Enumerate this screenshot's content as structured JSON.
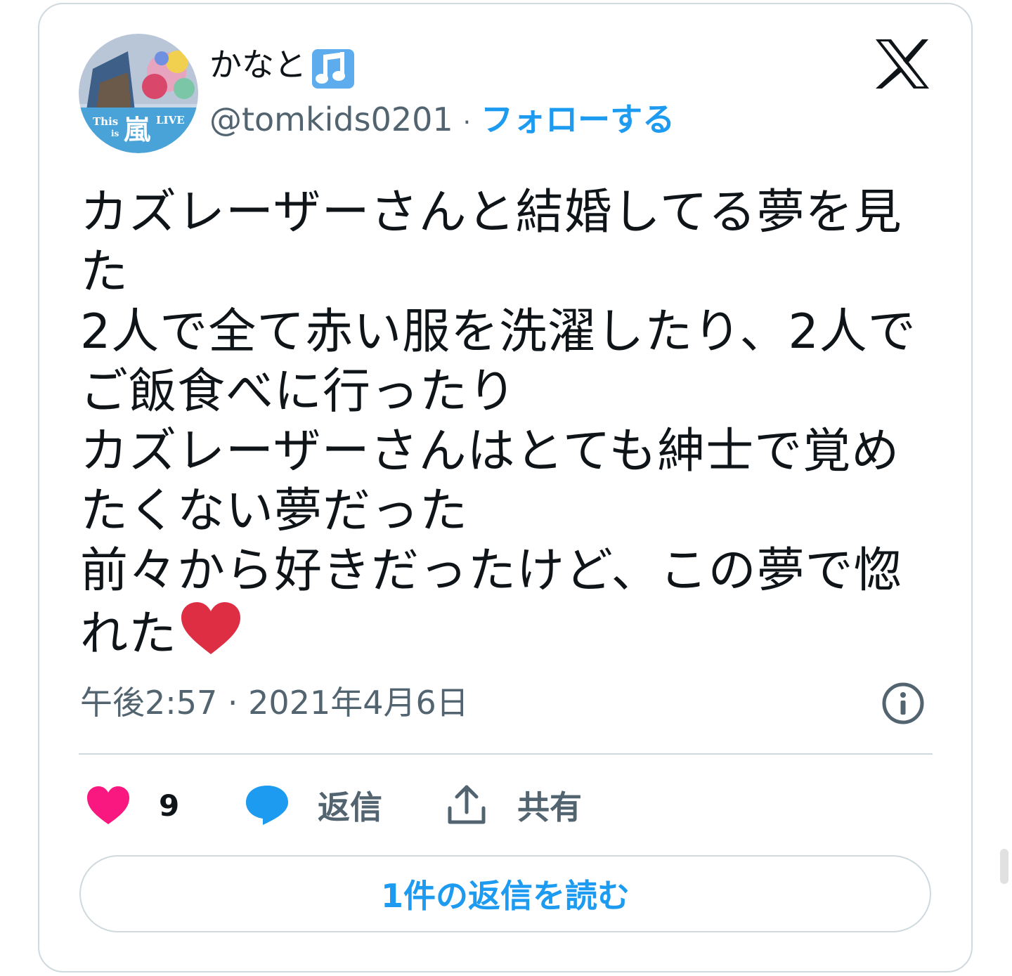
{
  "author": {
    "display_name": "かなと",
    "handle": "@tomkids0201",
    "separator": "·",
    "follow_label": "フォローする",
    "avatar_text": {
      "this": "This",
      "is": "is",
      "kanji": "嵐",
      "live": "LIVE"
    }
  },
  "tweet": {
    "text": "カズレーザーさんと結婚してる夢を見た\n2人で全て赤い服を洗濯したり、2人でご飯食べに行ったり\nカズレーザーさんはとても紳士で覚めたくない夢だった\n前々から好きだったけど、この夢で惚れた",
    "emoji": "❤️",
    "timestamp": "午後2:57 · 2021年4月6日"
  },
  "actions": {
    "like_count": "9",
    "reply_label": "返信",
    "share_label": "共有"
  },
  "read_replies_label": "1件の返信を読む",
  "icons": {
    "music": "music-note-icon",
    "x_logo": "x-logo-icon",
    "info": "info-icon",
    "heart": "heart-icon",
    "reply": "reply-bubble-icon",
    "share": "share-icon"
  },
  "colors": {
    "accent": "#1d9bf0",
    "like": "#f91880",
    "text": "#0f1419",
    "secondary": "#536471",
    "border": "#cfd9de",
    "heart_emoji": "#dd2e44"
  }
}
